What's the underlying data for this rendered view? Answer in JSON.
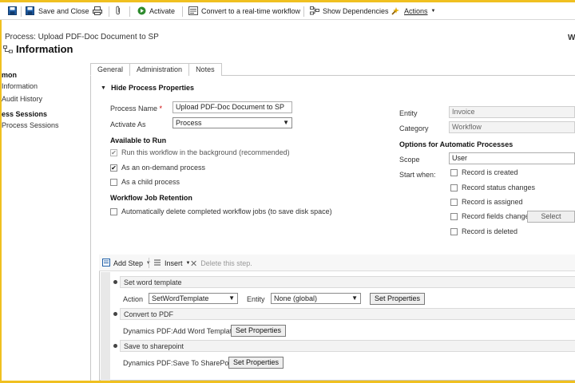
{
  "toolbar": {
    "save_close": "Save and Close",
    "activate": "Activate",
    "convert": "Convert to a real-time workflow",
    "show_dependencies": "Show Dependencies",
    "actions": "Actions"
  },
  "header": {
    "process_title": "Process: Upload PDF-Doc Document to SP",
    "section_title": "Information",
    "right_letter": "W"
  },
  "nav": {
    "group1": "mon",
    "items1": [
      "Information",
      "Audit History"
    ],
    "group2": "ess Sessions",
    "items2": [
      "Process Sessions"
    ]
  },
  "tabs": [
    "General",
    "Administration",
    "Notes"
  ],
  "general": {
    "section_header": "Hide Process Properties",
    "process_name_label": "Process Name",
    "required_mark": "*",
    "process_name_value": "Upload PDF-Doc Document to SP",
    "activate_as_label": "Activate As",
    "activate_as_value": "Process",
    "available_header": "Available to Run",
    "run_background": "Run this workflow in the background (recommended)",
    "on_demand": "As an on-demand process",
    "child_process": "As a child process",
    "retention_header": "Workflow Job Retention",
    "auto_delete": "Automatically delete completed workflow jobs (to save disk space)",
    "entity_label": "Entity",
    "entity_value": "Invoice",
    "category_label": "Category",
    "category_value": "Workflow",
    "options_header": "Options for Automatic Processes",
    "scope_label": "Scope",
    "scope_value": "User",
    "start_when_label": "Start when:",
    "start_options": [
      "Record is created",
      "Record status changes",
      "Record is assigned",
      "Record fields change",
      "Record is deleted"
    ],
    "select_button": "Select"
  },
  "steps": {
    "add_step": "Add Step",
    "insert": "Insert",
    "delete": "Delete this step.",
    "step1_title": "Set word template",
    "action_label": "Action",
    "action_value": "SetWordTemplate",
    "entity_label": "Entity",
    "entity_value": "None (global)",
    "set_properties": "Set Properties",
    "step2_title": "Convert to PDF",
    "step2_action": "Dynamics PDF:Add Word Template",
    "step3_title": "Save to sharepoint",
    "step3_action": "Dynamics PDF:Save To SharePoint"
  },
  "state": {
    "run_background_checked": true,
    "on_demand_checked": true,
    "child_process_checked": false,
    "auto_delete_checked": false
  },
  "colors": {
    "frame_accent": "#f0c020",
    "activate_icon": "#2e8b2e",
    "save_icon": "#1f5fa8"
  }
}
